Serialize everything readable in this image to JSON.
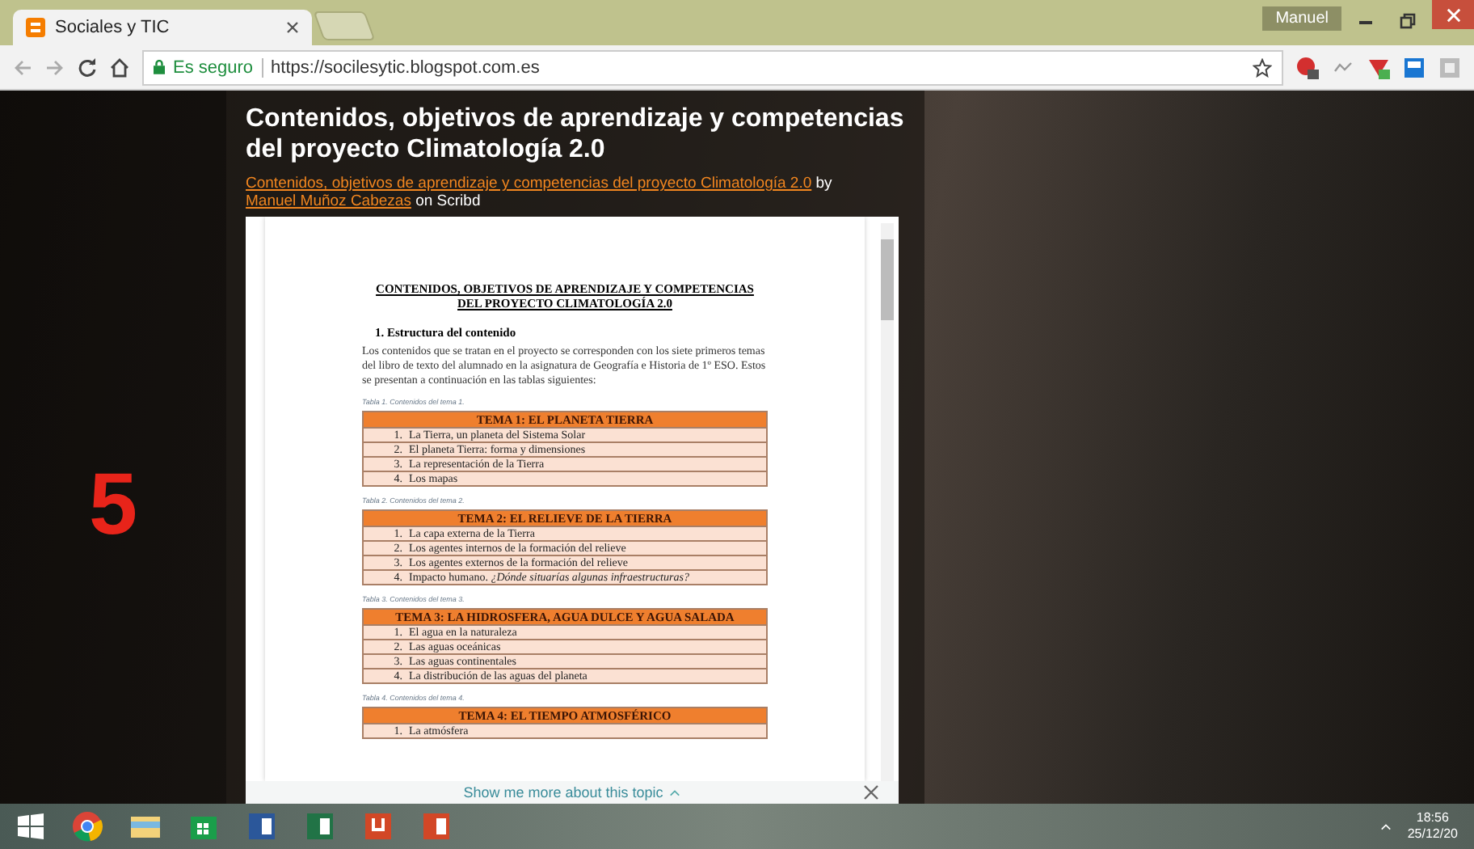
{
  "browser": {
    "tabs": [
      {
        "title": "Sociales y TIC",
        "selected": true
      }
    ],
    "user": "Manuel",
    "security_label": "Es seguro",
    "url": "https://socilesytic.blogspot.com.es"
  },
  "page": {
    "slide_number": "5",
    "title": "Contenidos, objetivos de aprendizaje y competencias del proyecto Climatología 2.0",
    "link": "Contenidos, objetivos de aprendizaje y competencias del proyecto Climatología 2.0",
    "by": "by",
    "author": "Manuel Muñoz Cabezas",
    "on": "on Scribd"
  },
  "document": {
    "title": "CONTENIDOS, OBJETIVOS DE APRENDIZAJE Y COMPETENCIAS DEL PROYECTO CLIMATOLOGÍA 2.0",
    "section": "1.  Estructura del contenido",
    "paragraph": "Los contenidos que se tratan en el proyecto se corresponden con los siete primeros temas del libro de texto del alumnado en la asignatura de Geografía e Historia de 1º ESO. Estos se presentan a continuación en las tablas siguientes:",
    "tables": [
      {
        "caption": "Tabla 1. Contenidos del tema 1.",
        "header": "TEMA 1: EL PLANETA TIERRA",
        "items": [
          {
            "number": "1.",
            "text": "La Tierra, un planeta del Sistema Solar"
          },
          {
            "number": "2.",
            "text": "El planeta Tierra: forma y dimensiones"
          },
          {
            "number": "3.",
            "text": "La representación de la Tierra"
          },
          {
            "number": "4.",
            "text": "Los mapas"
          }
        ]
      },
      {
        "caption": "Tabla 2. Contenidos del tema 2.",
        "header": "TEMA 2: EL RELIEVE DE LA TIERRA",
        "items": [
          {
            "number": "1.",
            "text": "La capa externa de la Tierra"
          },
          {
            "number": "2.",
            "text": "Los agentes internos de la formación del relieve"
          },
          {
            "number": "3.",
            "text": "Los agentes externos de la formación del relieve"
          },
          {
            "number": "4.",
            "text": "Impacto humano. *¿Dónde situarías algunas infraestructuras?*"
          }
        ]
      },
      {
        "caption": "Tabla 3. Contenidos del tema 3.",
        "header": "TEMA 3: LA HIDROSFERA, AGUA DULCE Y AGUA SALADA",
        "items": [
          {
            "number": "1.",
            "text": "El agua en la naturaleza"
          },
          {
            "number": "2.",
            "text": "Las aguas oceánicas"
          },
          {
            "number": "3.",
            "text": "Las aguas continentales"
          },
          {
            "number": "4.",
            "text": "La distribución de las aguas del planeta"
          }
        ]
      },
      {
        "caption": "Tabla 4. Contenidos del tema 4.",
        "header": "TEMA 4: EL TIEMPO ATMOSFÉRICO",
        "items": [
          {
            "number": "1.",
            "text": "La atmósfera"
          }
        ]
      }
    ]
  },
  "topic_bar": {
    "label": "Show me more about this topic"
  },
  "taskbar": {
    "time": "18:56",
    "date": "25/12/20"
  }
}
